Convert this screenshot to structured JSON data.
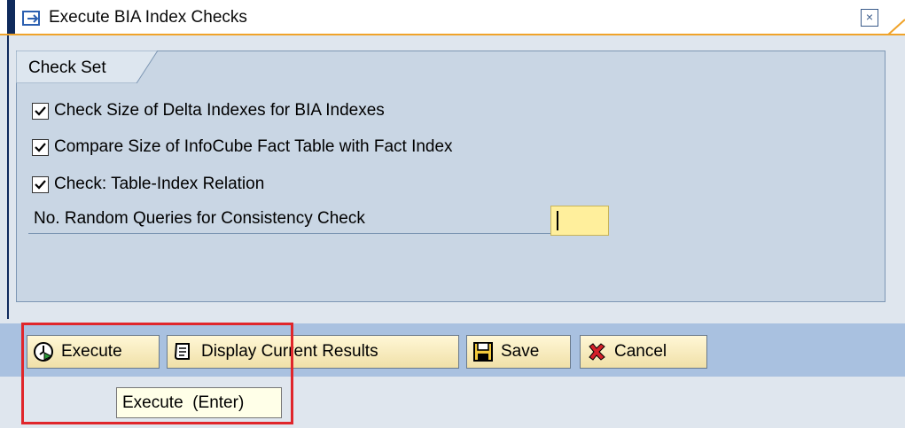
{
  "dialog": {
    "title": "Execute BIA Index Checks",
    "close_symbol": "×"
  },
  "check_set": {
    "group_label": "Check Set",
    "checks": [
      {
        "label": "Check Size of Delta Indexes for BIA Indexes",
        "checked": true
      },
      {
        "label": "Compare Size of InfoCube Fact Table with Fact Index",
        "checked": true
      },
      {
        "label": "Check: Table-Index Relation",
        "checked": true
      }
    ],
    "random_queries": {
      "label": "No. Random Queries for Consistency Check",
      "value": ""
    }
  },
  "toolbar": {
    "execute_label": "Execute",
    "display_label": "Display Current Results",
    "save_label": "Save",
    "cancel_label": "Cancel"
  },
  "tooltip": {
    "text": "Execute  (Enter)"
  },
  "icons": {
    "title": "dialog-icon",
    "execute": "clock-execute-icon",
    "display": "scroll-display-icon",
    "save": "floppy-save-icon",
    "cancel": "red-x-cancel-icon"
  },
  "colors": {
    "highlight": "#e0262b",
    "toolbar_bg": "#a9c1e0",
    "input_bg": "#ffef9c",
    "title_accent": "#f0a32a"
  }
}
